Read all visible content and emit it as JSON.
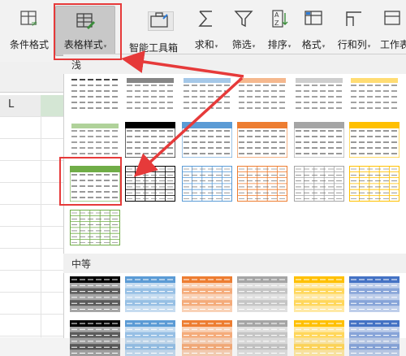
{
  "ribbon": {
    "buttons": [
      {
        "id": "cond",
        "label": "条件格式",
        "caret": false
      },
      {
        "id": "tablestyle",
        "label": "表格样式",
        "caret": true
      },
      {
        "id": "smart",
        "label": "智能工具箱",
        "caret": false
      },
      {
        "id": "sum",
        "label": "求和",
        "caret": true
      },
      {
        "id": "filter",
        "label": "筛选",
        "caret": true
      },
      {
        "id": "sort",
        "label": "排序",
        "caret": true
      },
      {
        "id": "format",
        "label": "格式",
        "caret": true
      },
      {
        "id": "rowcol",
        "label": "行和列",
        "caret": true
      },
      {
        "id": "sheet",
        "label": "工作表",
        "caret": false
      }
    ],
    "caret_glyph": "▾",
    "sort_icon_text": "A\nZ"
  },
  "spreadsheet": {
    "column_label": "L"
  },
  "gallery": {
    "light_label": "浅",
    "medium_label": "中等"
  },
  "colors": {
    "highlight": "#e63a3a",
    "green": "#70ad47",
    "blue": "#5b9bd5",
    "orange": "#ed7d31",
    "gray": "#a5a5a5",
    "yellow": "#ffc000",
    "navy": "#4472c4",
    "black": "#000000"
  }
}
